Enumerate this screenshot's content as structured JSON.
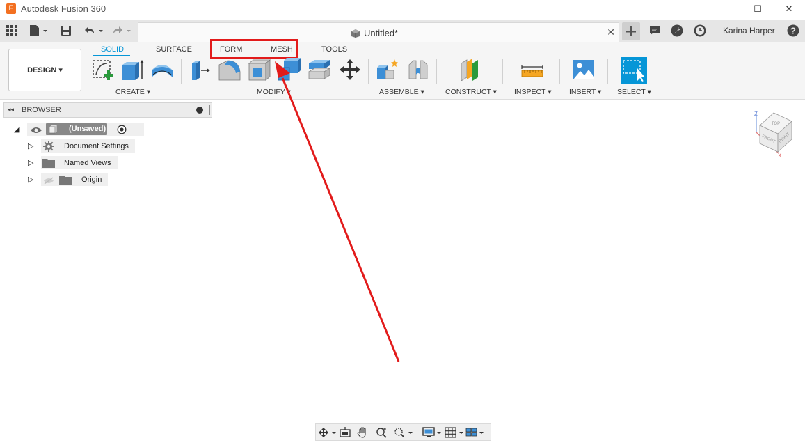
{
  "window": {
    "app_title": "Autodesk Fusion 360",
    "logo_letter": "F",
    "minimize": "—",
    "maximize": "☐",
    "close": "✕"
  },
  "appbar": {
    "document_title": "Untitled*",
    "tab_close": "✕",
    "user_name": "Karina Harper"
  },
  "toolbar": {
    "workspace": "DESIGN ▾",
    "tabs": [
      {
        "label": "SOLID",
        "active": true
      },
      {
        "label": "SURFACE",
        "active": false
      },
      {
        "label": "FORM",
        "active": false
      },
      {
        "label": "MESH",
        "active": false
      },
      {
        "label": "TOOLS",
        "active": false
      }
    ],
    "groups": [
      {
        "label": "CREATE ▾"
      },
      {
        "label": "MODIFY ▾"
      },
      {
        "label": "ASSEMBLE ▾"
      },
      {
        "label": "CONSTRUCT ▾"
      },
      {
        "label": "INSPECT ▾"
      },
      {
        "label": "INSERT ▾"
      },
      {
        "label": "SELECT ▾"
      }
    ],
    "highlight_color": "#e21b1b",
    "accent_color": "#0696d7"
  },
  "browser": {
    "collapse_icon": "◂◂",
    "title": "BROWSER",
    "root": {
      "label": "(Unsaved)",
      "expander": "◢"
    },
    "items": [
      {
        "label": "Document Settings",
        "icon": "gear-icon",
        "expander": "▷"
      },
      {
        "label": "Named Views",
        "icon": "folder-icon",
        "expander": "▷"
      },
      {
        "label": "Origin",
        "icon": "folder-icon",
        "expander": "▷"
      }
    ]
  },
  "viewcube": {
    "z": "Z",
    "x": "X",
    "top": "TOP",
    "front": "FRONT",
    "right": "RIGHT"
  }
}
